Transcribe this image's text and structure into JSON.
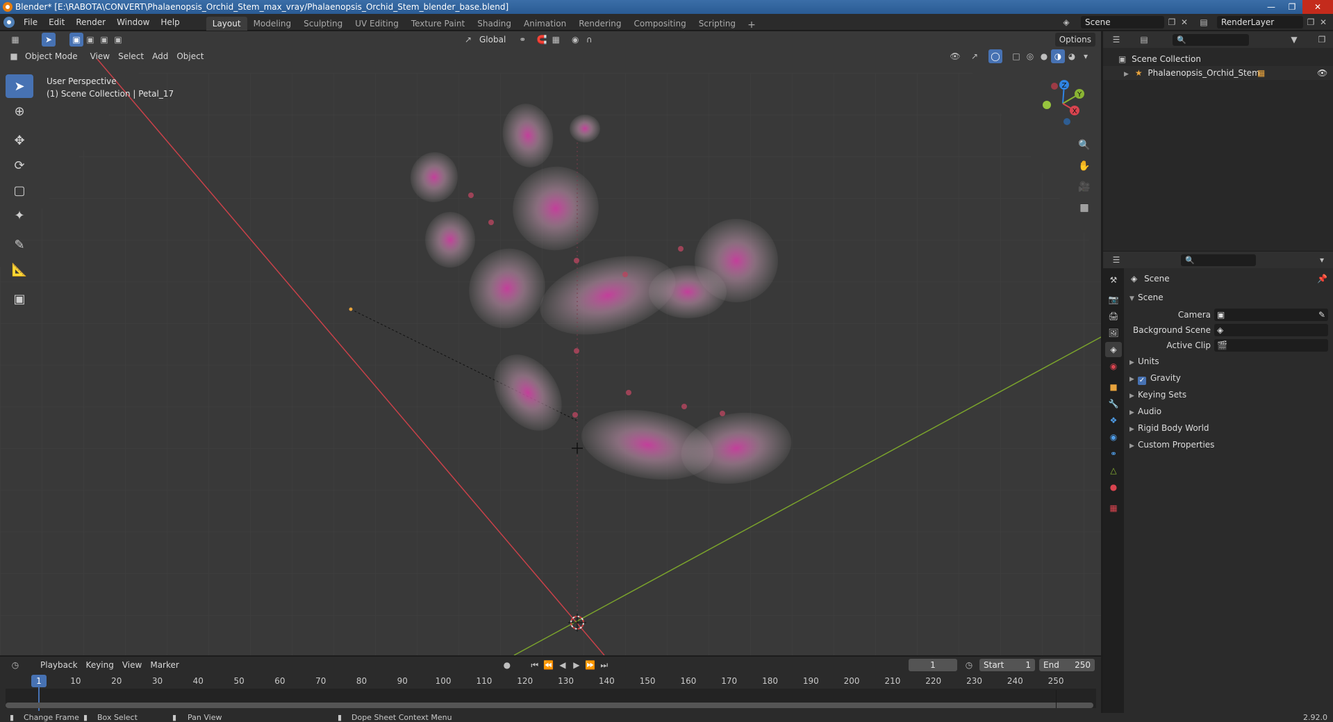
{
  "window": {
    "title": "Blender* [E:\\RABOTA\\CONVERT\\Phalaenopsis_Orchid_Stem_max_vray/Phalaenopsis_Orchid_Stem_blender_base.blend]"
  },
  "menu": {
    "items": [
      "File",
      "Edit",
      "Render",
      "Window",
      "Help"
    ]
  },
  "workspaces": {
    "tabs": [
      "Layout",
      "Modeling",
      "Sculpting",
      "UV Editing",
      "Texture Paint",
      "Shading",
      "Animation",
      "Rendering",
      "Compositing",
      "Scripting"
    ],
    "active": "Layout"
  },
  "scene_selector": {
    "scene": "Scene",
    "render_layer": "RenderLayer"
  },
  "viewport": {
    "mode": "Object Mode",
    "menus": [
      "View",
      "Select",
      "Add",
      "Object"
    ],
    "orientation": "Global",
    "options": "Options",
    "overlay_title": "User Perspective",
    "overlay_subtitle": "(1) Scene Collection | Petal_17",
    "gizmo_axes": {
      "z": "Z",
      "y": "Y",
      "x": "X"
    }
  },
  "timeline": {
    "menus": [
      "Playback",
      "Keying",
      "View",
      "Marker"
    ],
    "current_frame": "1",
    "start_label": "Start",
    "start": "1",
    "end_label": "End",
    "end": "250",
    "ruler": [
      "1",
      "10",
      "20",
      "30",
      "40",
      "50",
      "60",
      "70",
      "80",
      "90",
      "100",
      "110",
      "120",
      "130",
      "140",
      "150",
      "160",
      "170",
      "180",
      "190",
      "200",
      "210",
      "220",
      "230",
      "240",
      "250"
    ]
  },
  "statusbar": {
    "items": [
      "Change Frame",
      "Box Select",
      "Pan View",
      "Dope Sheet Context Menu"
    ],
    "version": "2.92.0"
  },
  "outliner": {
    "root": "Scene Collection",
    "items": [
      {
        "name": "Phalaenopsis_Orchid_Stem"
      }
    ]
  },
  "properties": {
    "context": "Scene",
    "section": "Scene",
    "fields": [
      {
        "label": "Camera"
      },
      {
        "label": "Background Scene"
      },
      {
        "label": "Active Clip"
      }
    ],
    "panels": [
      "Units",
      "Gravity",
      "Keying Sets",
      "Audio",
      "Rigid Body World",
      "Custom Properties"
    ],
    "gravity_checked": true
  },
  "colors": {
    "accent": "#4772b3",
    "x_axis": "#d9444f",
    "y_axis": "#8ab433",
    "z_axis": "#2f84e3",
    "viewport_bg": "#393939"
  }
}
